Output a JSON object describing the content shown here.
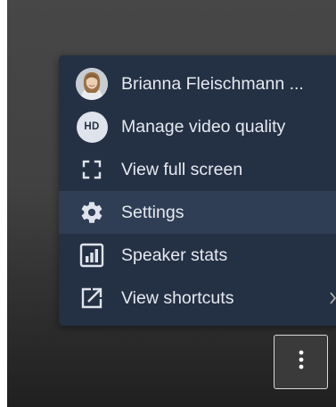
{
  "menu": {
    "items": [
      {
        "label": "Brianna Fleischmann ...",
        "icon": "user-avatar",
        "active": false
      },
      {
        "label": "Manage video quality",
        "icon": "hd-badge-icon",
        "badge_text": "HD",
        "active": false
      },
      {
        "label": "View full screen",
        "icon": "fullscreen-icon",
        "active": false
      },
      {
        "label": "Settings",
        "icon": "gear-icon",
        "active": true
      },
      {
        "label": "Speaker stats",
        "icon": "bar-chart-icon",
        "active": false
      },
      {
        "label": "View shortcuts",
        "icon": "external-link-icon",
        "active": false
      }
    ]
  },
  "toolbar": {
    "more_button_icon": "vertical-ellipsis-icon"
  },
  "colors": {
    "menu_background": "#243044",
    "menu_active_background": "#2f3d55",
    "menu_text": "#e6eaf0",
    "icon_color": "#dfe4ec"
  }
}
